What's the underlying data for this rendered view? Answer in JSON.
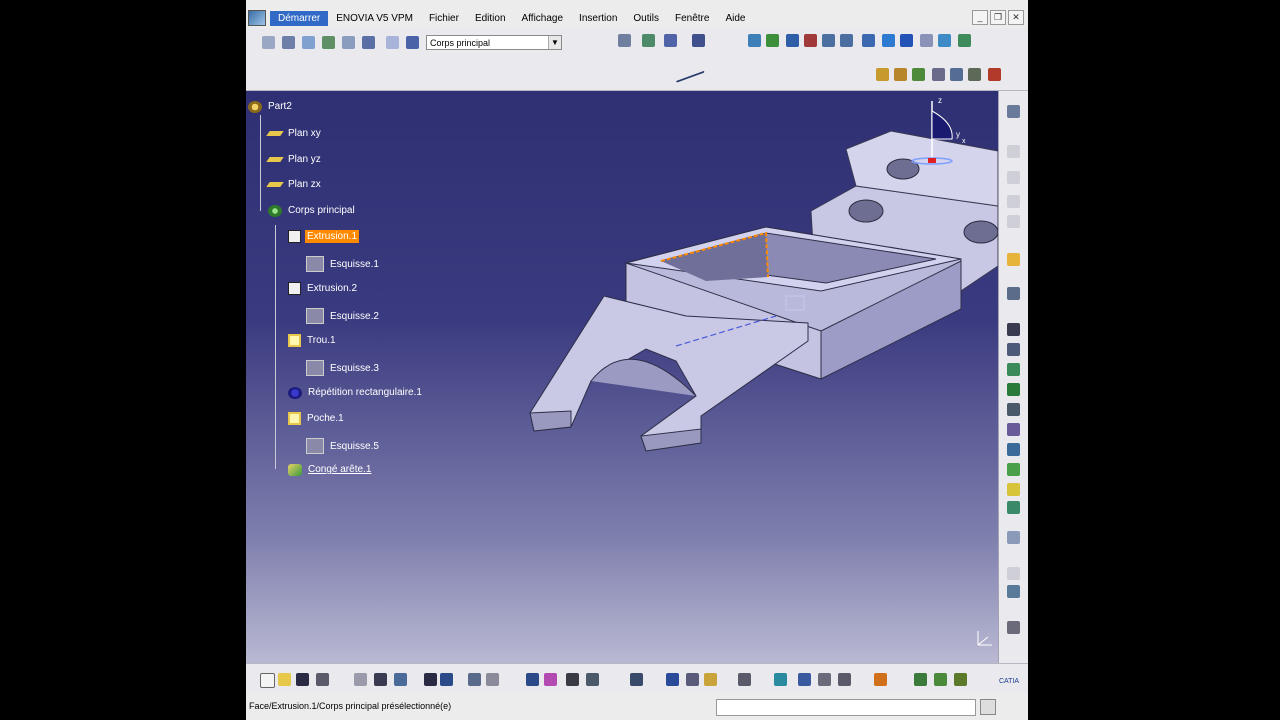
{
  "menubar": {
    "items": [
      "Démarrer",
      "ENOVIA V5 VPM",
      "Fichier",
      "Edition",
      "Affichage",
      "Insertion",
      "Outils",
      "Fenêtre",
      "Aide"
    ],
    "active_index": 0
  },
  "toolbar": {
    "body_select_value": "Corps principal"
  },
  "tree": {
    "root": "Part2",
    "nodes": [
      {
        "label": "Plan xy",
        "icon": "plane-icon"
      },
      {
        "label": "Plan yz",
        "icon": "plane-icon"
      },
      {
        "label": "Plan zx",
        "icon": "plane-icon"
      },
      {
        "label": "Corps principal",
        "icon": "body-icon"
      },
      {
        "label": "Extrusion.1",
        "icon": "pad-icon",
        "selected": true
      },
      {
        "label": "Esquisse.1",
        "icon": "sketch-icon"
      },
      {
        "label": "Extrusion.2",
        "icon": "pad-icon"
      },
      {
        "label": "Esquisse.2",
        "icon": "sketch-icon"
      },
      {
        "label": "Trou.1",
        "icon": "hole-icon"
      },
      {
        "label": "Esquisse.3",
        "icon": "sketch-icon"
      },
      {
        "label": "Répétition rectangulaire.1",
        "icon": "pattern-icon"
      },
      {
        "label": "Poche.1",
        "icon": "pocket-icon"
      },
      {
        "label": "Esquisse.5",
        "icon": "sketch-icon"
      },
      {
        "label": "Congé arête.1",
        "icon": "fillet-icon"
      }
    ]
  },
  "compass": {
    "z": "z",
    "y": "y",
    "x": "x"
  },
  "status": {
    "text": "Face/Extrusion.1/Corps principal présélectionné(e)"
  },
  "logo": "CATIA",
  "colors": {
    "selection": "#ff8a00",
    "viewport_top": "#2f2f73",
    "viewport_bottom": "#b9b9d3",
    "part": "#c9c9e6",
    "menu_active": "#3169c6"
  }
}
